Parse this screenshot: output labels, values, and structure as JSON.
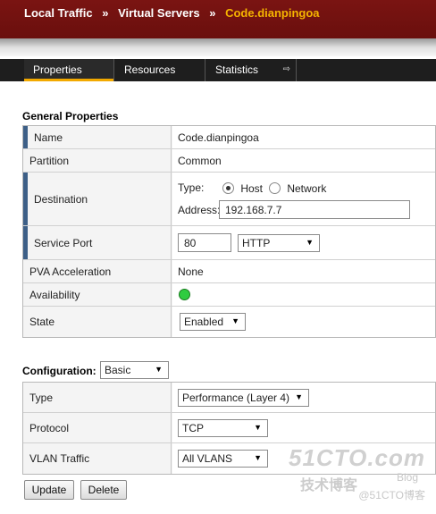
{
  "header": {
    "crumbs": [
      "Local Traffic",
      "Virtual Servers"
    ],
    "separator": "»",
    "current": "Code.dianpingoa"
  },
  "tabs": [
    {
      "label": "Properties",
      "active": true
    },
    {
      "label": "Resources",
      "active": false
    },
    {
      "label": "Statistics",
      "active": false
    }
  ],
  "tab_overflow_icon": "⇨",
  "general": {
    "title": "General Properties",
    "name": {
      "label": "Name",
      "value": "Code.dianpingoa"
    },
    "partition": {
      "label": "Partition",
      "value": "Common"
    },
    "destination": {
      "label": "Destination",
      "type_label": "Type:",
      "options": [
        "Host",
        "Network"
      ],
      "selected": "Host",
      "address_label": "Address:",
      "address_value": "192.168.7.7"
    },
    "service_port": {
      "label": "Service Port",
      "port": "80",
      "protocol": "HTTP"
    },
    "pva": {
      "label": "PVA Acceleration",
      "value": "None"
    },
    "availability": {
      "label": "Availability",
      "status_color": "#2ecc40"
    },
    "state": {
      "label": "State",
      "value": "Enabled"
    }
  },
  "configuration": {
    "title": "Configuration:",
    "mode": "Basic",
    "type": {
      "label": "Type",
      "value": "Performance (Layer 4)"
    },
    "protocol": {
      "label": "Protocol",
      "value": "TCP"
    },
    "vlan": {
      "label": "VLAN Traffic",
      "value": "All VLANS"
    }
  },
  "buttons": {
    "update": "Update",
    "delete": "Delete"
  },
  "watermark": {
    "main": "51CTO.com",
    "sub": "技术博客",
    "blog": "Blog",
    "credit": "@51CTO博客"
  },
  "colors": {
    "header": "#6a0f0d",
    "current_crumb": "#f5b400",
    "tab_underline": "#f2a900",
    "required_marker": "#3d5f87"
  }
}
